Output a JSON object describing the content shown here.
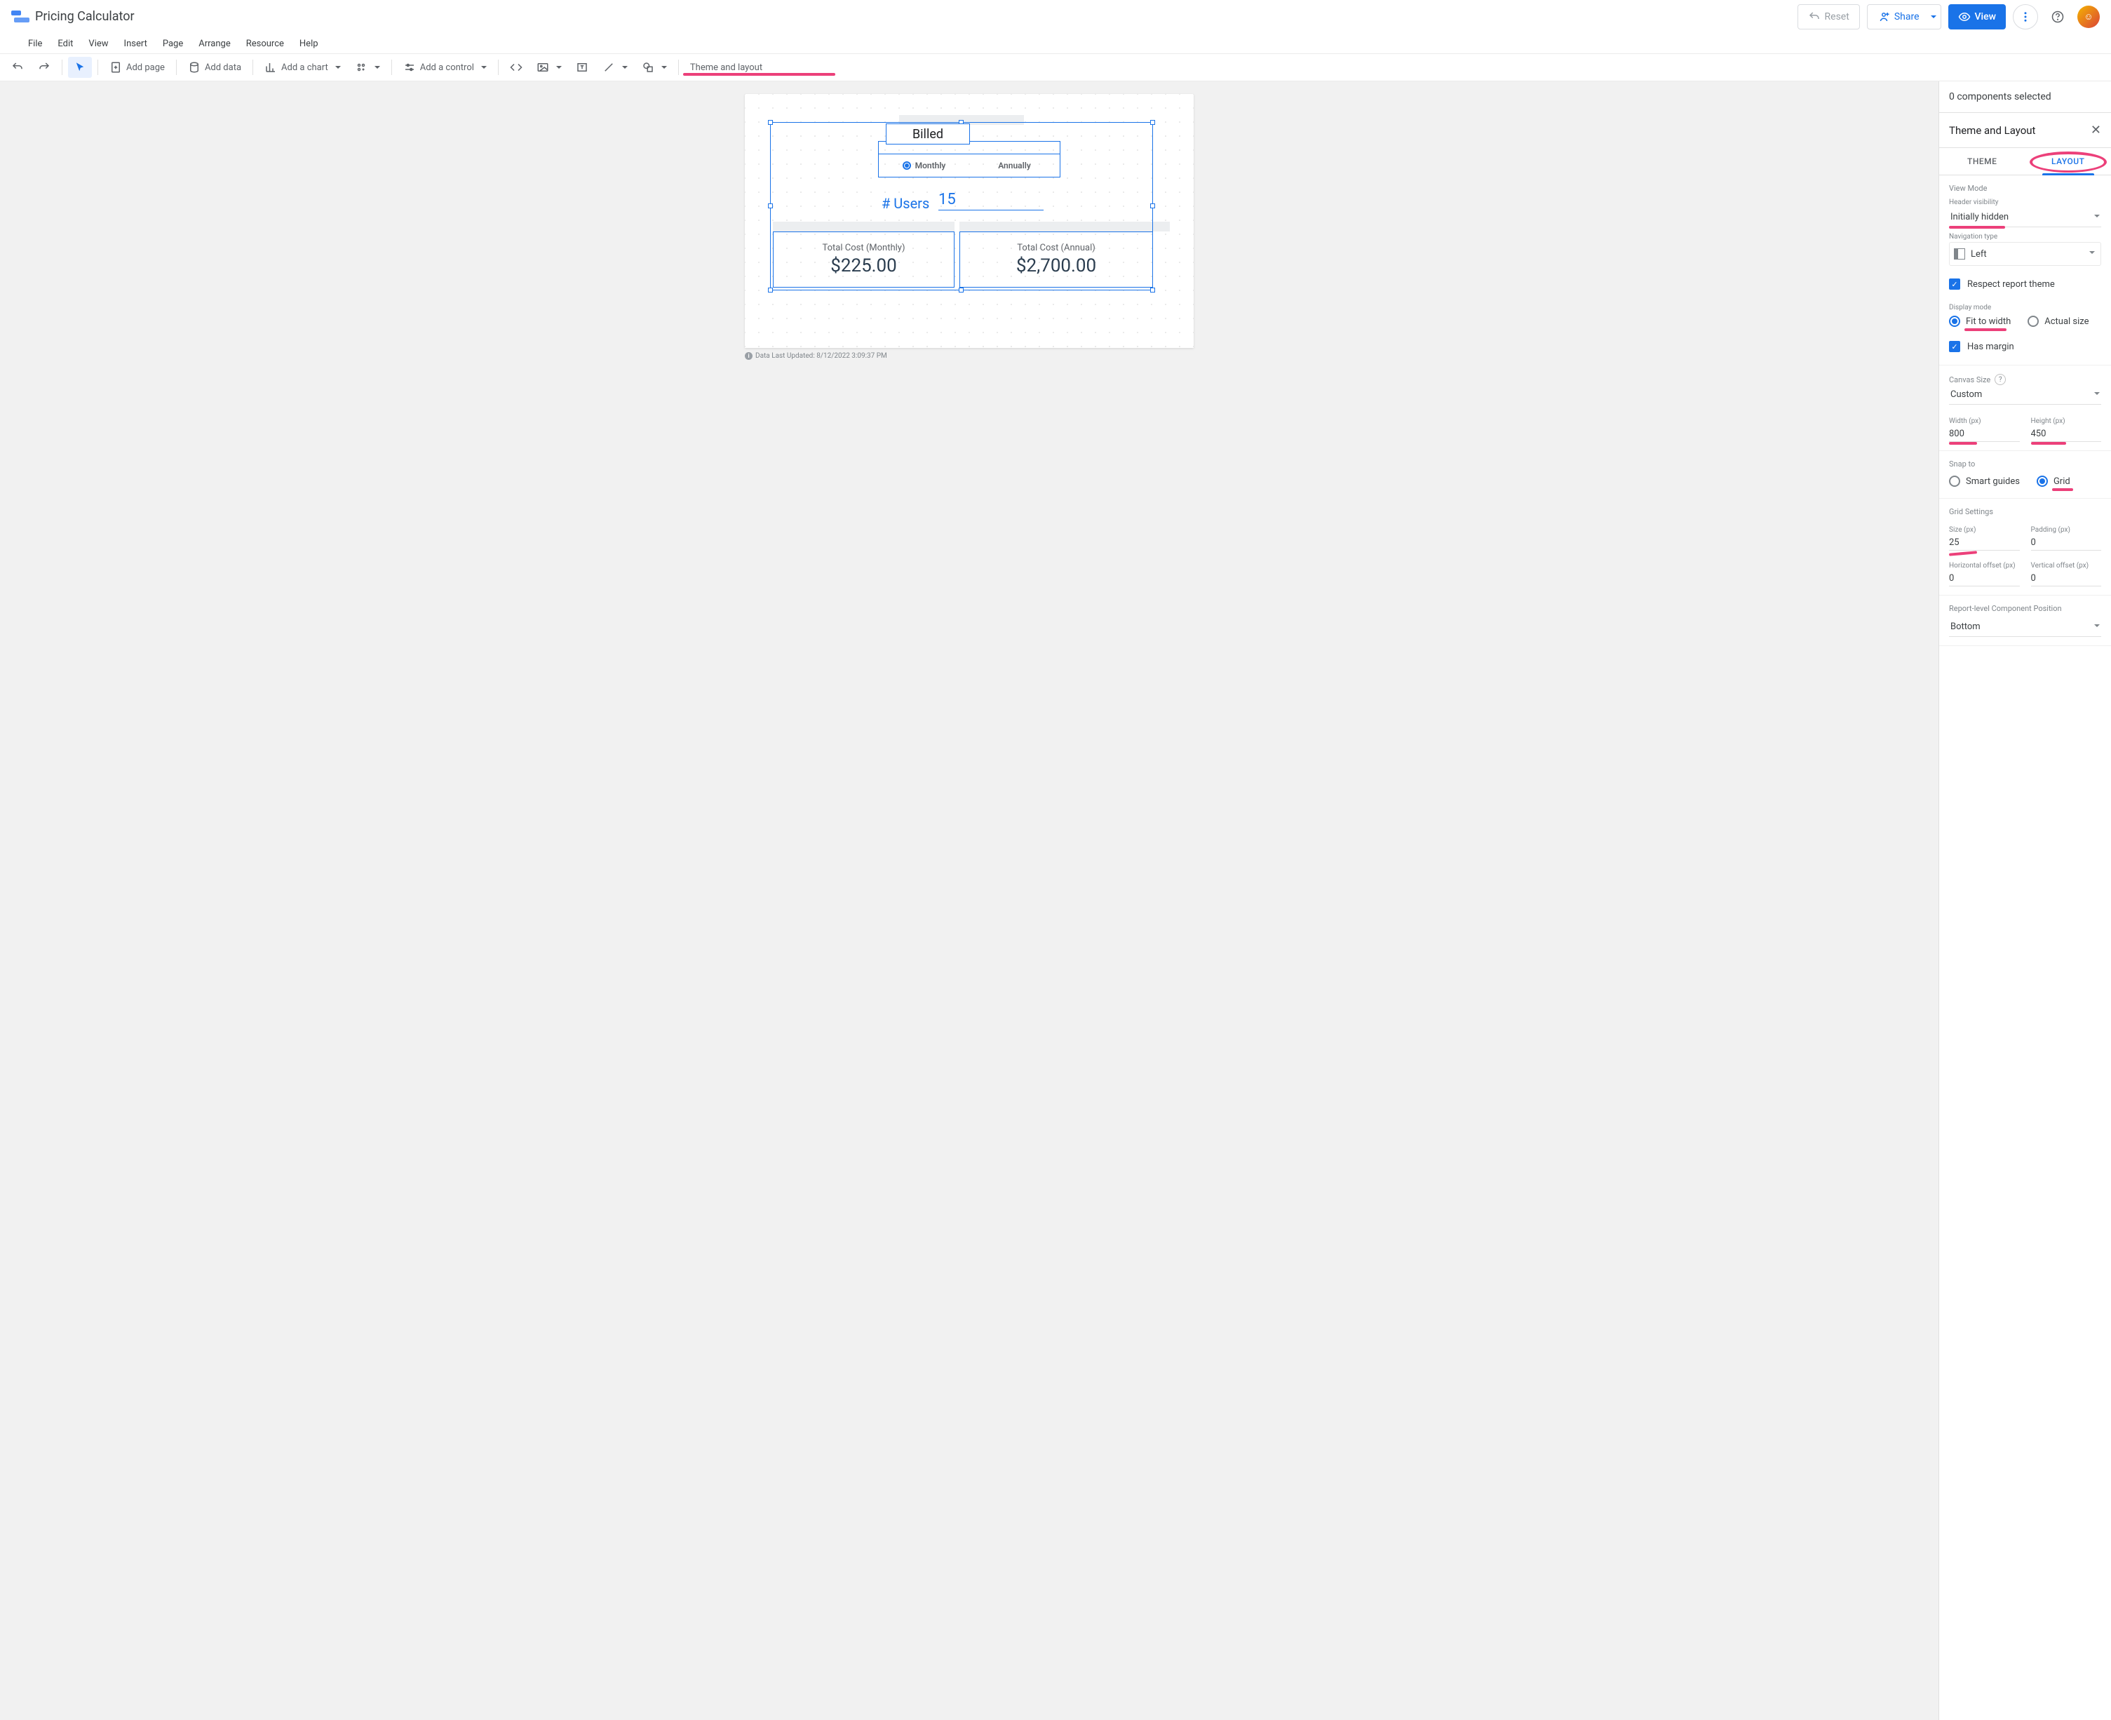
{
  "header": {
    "title": "Pricing Calculator",
    "reset": "Reset",
    "share": "Share",
    "view": "View"
  },
  "menu": {
    "file": "File",
    "edit": "Edit",
    "view": "View",
    "insert": "Insert",
    "page": "Page",
    "arrange": "Arrange",
    "resource": "Resource",
    "help": "Help"
  },
  "toolbar": {
    "add_page": "Add page",
    "add_data": "Add data",
    "add_chart": "Add a chart",
    "add_control": "Add a control",
    "theme_layout": "Theme and layout"
  },
  "report": {
    "billed_label": "Billed",
    "opt_monthly": "Monthly",
    "opt_annually": "Annually",
    "users_label": "# Users",
    "users_value": "15",
    "card1_title": "Total Cost (Monthly)",
    "card1_value": "$225.00",
    "card2_title": "Total Cost (Annual)",
    "card2_value": "$2,700.00",
    "footer": "Data Last Updated: 8/12/2022 3:09:37 PM"
  },
  "panel": {
    "status": "0 components selected",
    "title": "Theme and Layout",
    "tab_theme": "THEME",
    "tab_layout": "LAYOUT",
    "view_mode": "View Mode",
    "header_vis_label": "Header visibility",
    "header_vis_value": "Initially hidden",
    "nav_type_label": "Navigation type",
    "nav_type_value": "Left",
    "respect_theme": "Respect report theme",
    "display_mode_label": "Display mode",
    "fit_width": "Fit to width",
    "actual_size": "Actual size",
    "has_margin": "Has margin",
    "canvas_size_label": "Canvas Size",
    "canvas_size_value": "Custom",
    "width_label": "Width (px)",
    "width_value": "800",
    "height_label": "Height (px)",
    "height_value": "450",
    "snap_label": "Snap to",
    "smart_guides": "Smart guides",
    "grid": "Grid",
    "grid_settings": "Grid Settings",
    "size_label": "Size (px)",
    "size_value": "25",
    "padding_label": "Padding (px)",
    "padding_value": "0",
    "hoff_label": "Horizontal offset (px)",
    "hoff_value": "0",
    "voff_label": "Vertical offset (px)",
    "voff_value": "0",
    "comp_pos_label": "Report-level Component Position",
    "comp_pos_value": "Bottom"
  }
}
